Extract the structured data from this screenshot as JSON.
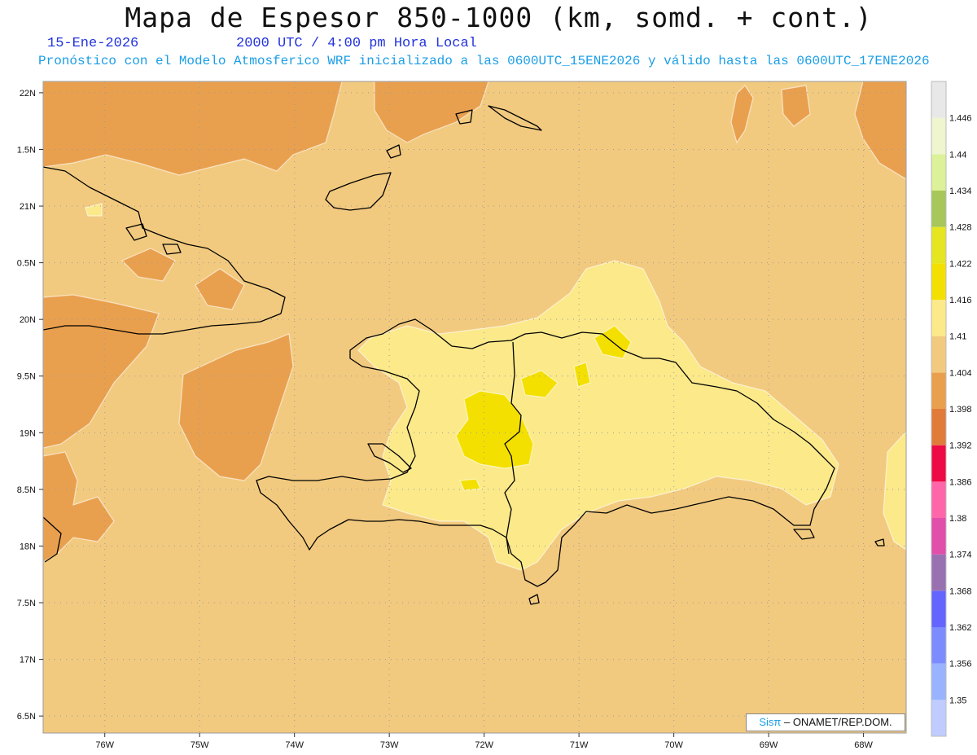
{
  "header": {
    "title": "Mapa de Espesor 850-1000 (km, somd. + cont.)",
    "date": "15-Ene-2026",
    "time": "2000 UTC / 4:00 pm Hora Local",
    "model_line": "Pronóstico con el Modelo Atmosferico WRF inicializado a las 0600UTC_15ENE2026 y válido hasta las  0600UTC_17ENE2026"
  },
  "map": {
    "lon_range": [
      -76.65,
      -67.55
    ],
    "lat_range": [
      16.35,
      22.1
    ],
    "lat_ticks": [
      {
        "value": 22,
        "label": "22N"
      },
      {
        "value": 21.5,
        "label": "1.5N"
      },
      {
        "value": 21,
        "label": "21N"
      },
      {
        "value": 20.5,
        "label": "0.5N"
      },
      {
        "value": 20,
        "label": "20N"
      },
      {
        "value": 19.5,
        "label": "9.5N"
      },
      {
        "value": 19,
        "label": "19N"
      },
      {
        "value": 18.5,
        "label": "8.5N"
      },
      {
        "value": 18,
        "label": "18N"
      },
      {
        "value": 17.5,
        "label": "7.5N"
      },
      {
        "value": 17,
        "label": "17N"
      },
      {
        "value": 16.5,
        "label": "6.5N"
      }
    ],
    "lon_ticks": [
      {
        "value": -76,
        "label": "76W"
      },
      {
        "value": -75,
        "label": "75W"
      },
      {
        "value": -74,
        "label": "74W"
      },
      {
        "value": -73,
        "label": "73W"
      },
      {
        "value": -72,
        "label": "72W"
      },
      {
        "value": -71,
        "label": "71W"
      },
      {
        "value": -70,
        "label": "70W"
      },
      {
        "value": -69,
        "label": "69W"
      },
      {
        "value": -68,
        "label": "68W"
      }
    ],
    "field_colors": {
      "base": "#f2ca7f",
      "low": "#e9a04e",
      "high": "#fbe98a",
      "higher": "#f4e000"
    }
  },
  "colorbar": {
    "levels": [
      "1.35",
      "1.356",
      "1.362",
      "1.368",
      "1.374",
      "1.38",
      "1.386",
      "1.392",
      "1.398",
      "1.404",
      "1.41",
      "1.416",
      "1.422",
      "1.428",
      "1.434",
      "1.44",
      "1.446"
    ],
    "colors": [
      "#c0ccff",
      "#99b3ff",
      "#7c8cff",
      "#6464ff",
      "#9a71b0",
      "#e14fab",
      "#ff66aa",
      "#ee0a44",
      "#e07b3a",
      "#e9a04e",
      "#f2ca7f",
      "#fbe98a",
      "#f4e000",
      "#e5e520",
      "#a7c75a",
      "#ddf09a",
      "#eef5cf",
      "#e8e8e8"
    ]
  },
  "credit": {
    "sis": "Sisπ",
    "rest": " – ONAMET/REP.DOM."
  }
}
